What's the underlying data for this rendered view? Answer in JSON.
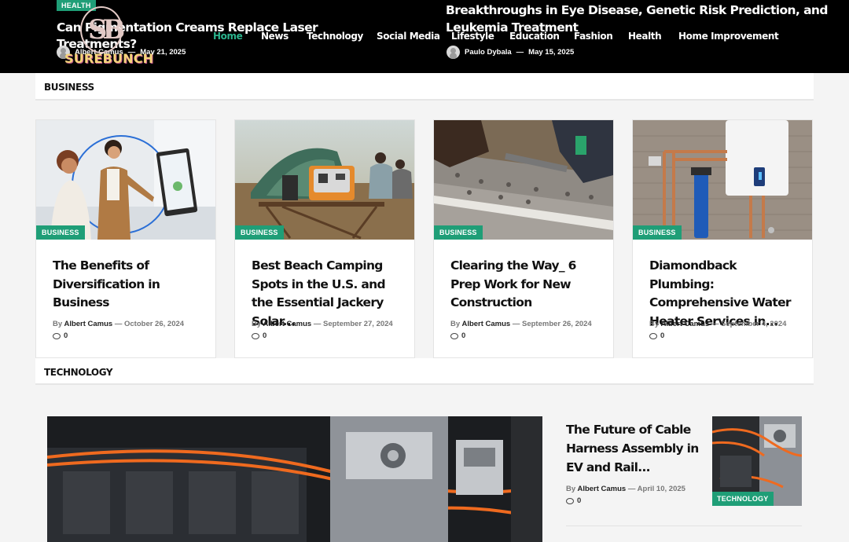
{
  "header": {
    "logo_text": "SUREBUNCH",
    "logo_mono": "SB",
    "headline_left": {
      "category": "HEALTH",
      "title": "Can Pigmentation Creams Replace Laser Treatments?",
      "author": "Albert Camus",
      "date": "May 21, 2025"
    },
    "headline_right": {
      "title_line1": "Breakthroughs in Eye Disease, Genetic Risk Prediction, and",
      "title_line2": "Leukemia Treatment",
      "author": "Paulo Dybala",
      "date": "May 15, 2025"
    },
    "nav": [
      "Home",
      "News",
      "Technology",
      "Social Media",
      "Lifestyle",
      "Education",
      "Fashion",
      "Health",
      "Home Improvement"
    ],
    "nav_active": "Home"
  },
  "business": {
    "heading": "BUSINESS",
    "cards": [
      {
        "category": "BUSINESS",
        "title": "The Benefits of Diversification in Business",
        "by": "By",
        "author": "Albert Camus",
        "date": "October 26, 2024",
        "comments": "0"
      },
      {
        "category": "BUSINESS",
        "title": "Best Beach Camping Spots in the U.S. and the Essential Jackery Solar...",
        "by": "By",
        "author": "Albert Camus",
        "date": "September 27, 2024",
        "comments": "0"
      },
      {
        "category": "BUSINESS",
        "title": "Clearing the Way_ 6 Prep Work for New Construction",
        "by": "By",
        "author": "Albert Camus",
        "date": "September 26, 2024",
        "comments": "0"
      },
      {
        "category": "BUSINESS",
        "title": "Diamondback Plumbing: Comprehensive Water Heater Services in...",
        "by": "By",
        "author": "Albert Camus",
        "date": "September 4, 2024",
        "comments": "0"
      }
    ]
  },
  "technology": {
    "heading": "TECHNOLOGY",
    "side": {
      "title": "The Future of Cable Harness Assembly in EV and Rail...",
      "by": "By",
      "author": "Albert Camus",
      "date": "April 10, 2025",
      "comments": "0",
      "category": "TECHNOLOGY"
    }
  },
  "colors": {
    "accent": "#1f9e77",
    "nav_active": "#2bb38d",
    "header_bg": "#000000"
  }
}
